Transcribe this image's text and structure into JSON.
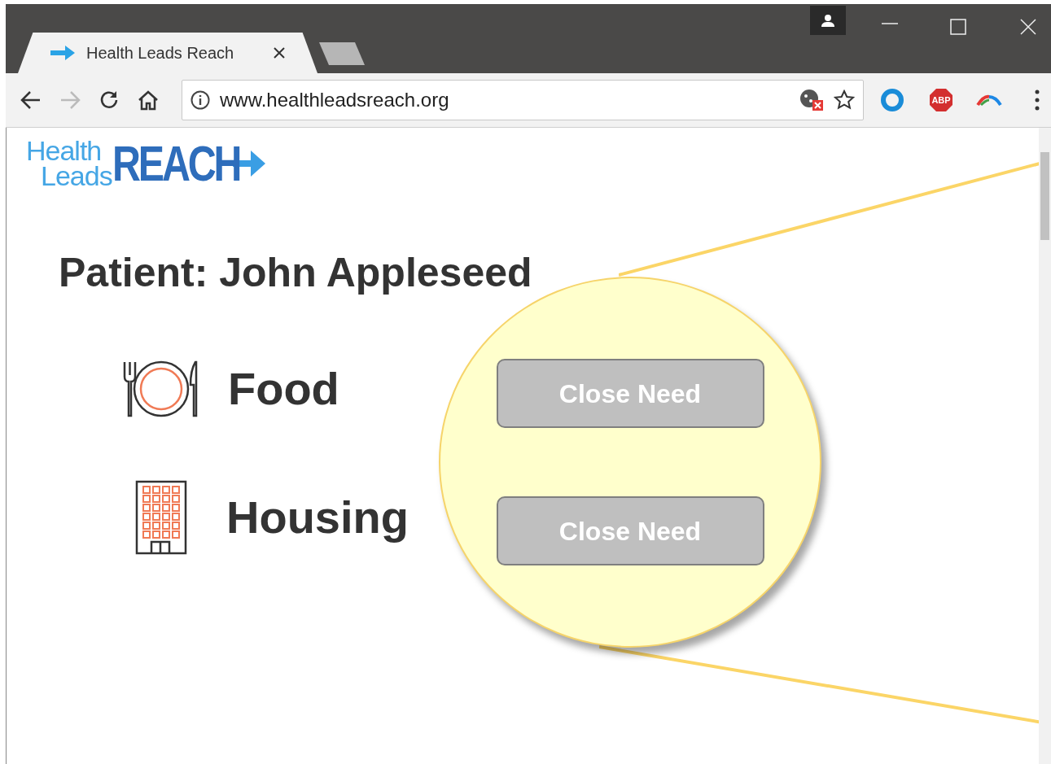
{
  "browser": {
    "tab_title": "Health Leads Reach",
    "address": "www.healthleadsreach.org",
    "extension_label": "ABP"
  },
  "logo": {
    "word_1": "Health",
    "word_2": "Leads",
    "word_3": "REACH"
  },
  "patient_title": "Patient: John Appleseed",
  "needs": [
    {
      "kind": "food",
      "label": "Food"
    },
    {
      "kind": "housing",
      "label": "Housing"
    }
  ],
  "magnifier": {
    "buttons": [
      {
        "label": "Close Need"
      },
      {
        "label": "Close Need"
      }
    ]
  }
}
